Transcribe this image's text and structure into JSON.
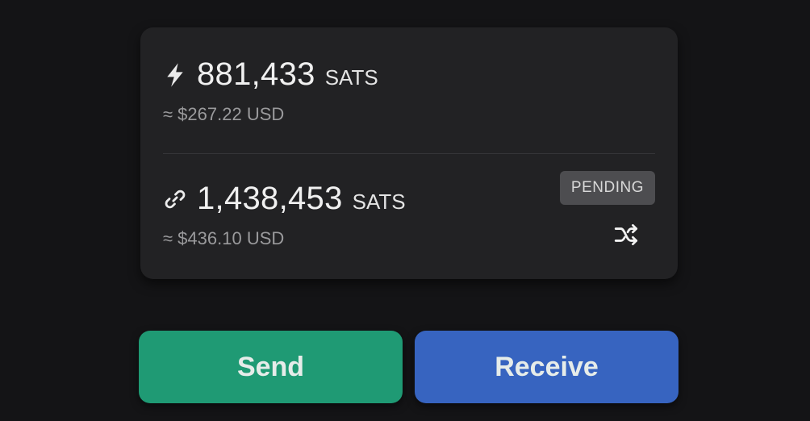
{
  "lightning": {
    "icon": "lightning-bolt-icon",
    "amount": "881,433",
    "unit": "SATS",
    "fiat": "≈ $267.22 USD"
  },
  "onchain": {
    "icon": "link-icon",
    "amount": "1,438,453",
    "unit": "SATS",
    "fiat": "≈ $436.10 USD",
    "status_badge": "PENDING",
    "action_icon": "shuffle-icon"
  },
  "actions": {
    "send_label": "Send",
    "receive_label": "Receive"
  },
  "colors": {
    "background": "#141416",
    "card": "#222224",
    "send": "#1f9a74",
    "receive": "#3764c0",
    "badge": "#4d4d50",
    "muted_text": "#9a9a9c"
  }
}
